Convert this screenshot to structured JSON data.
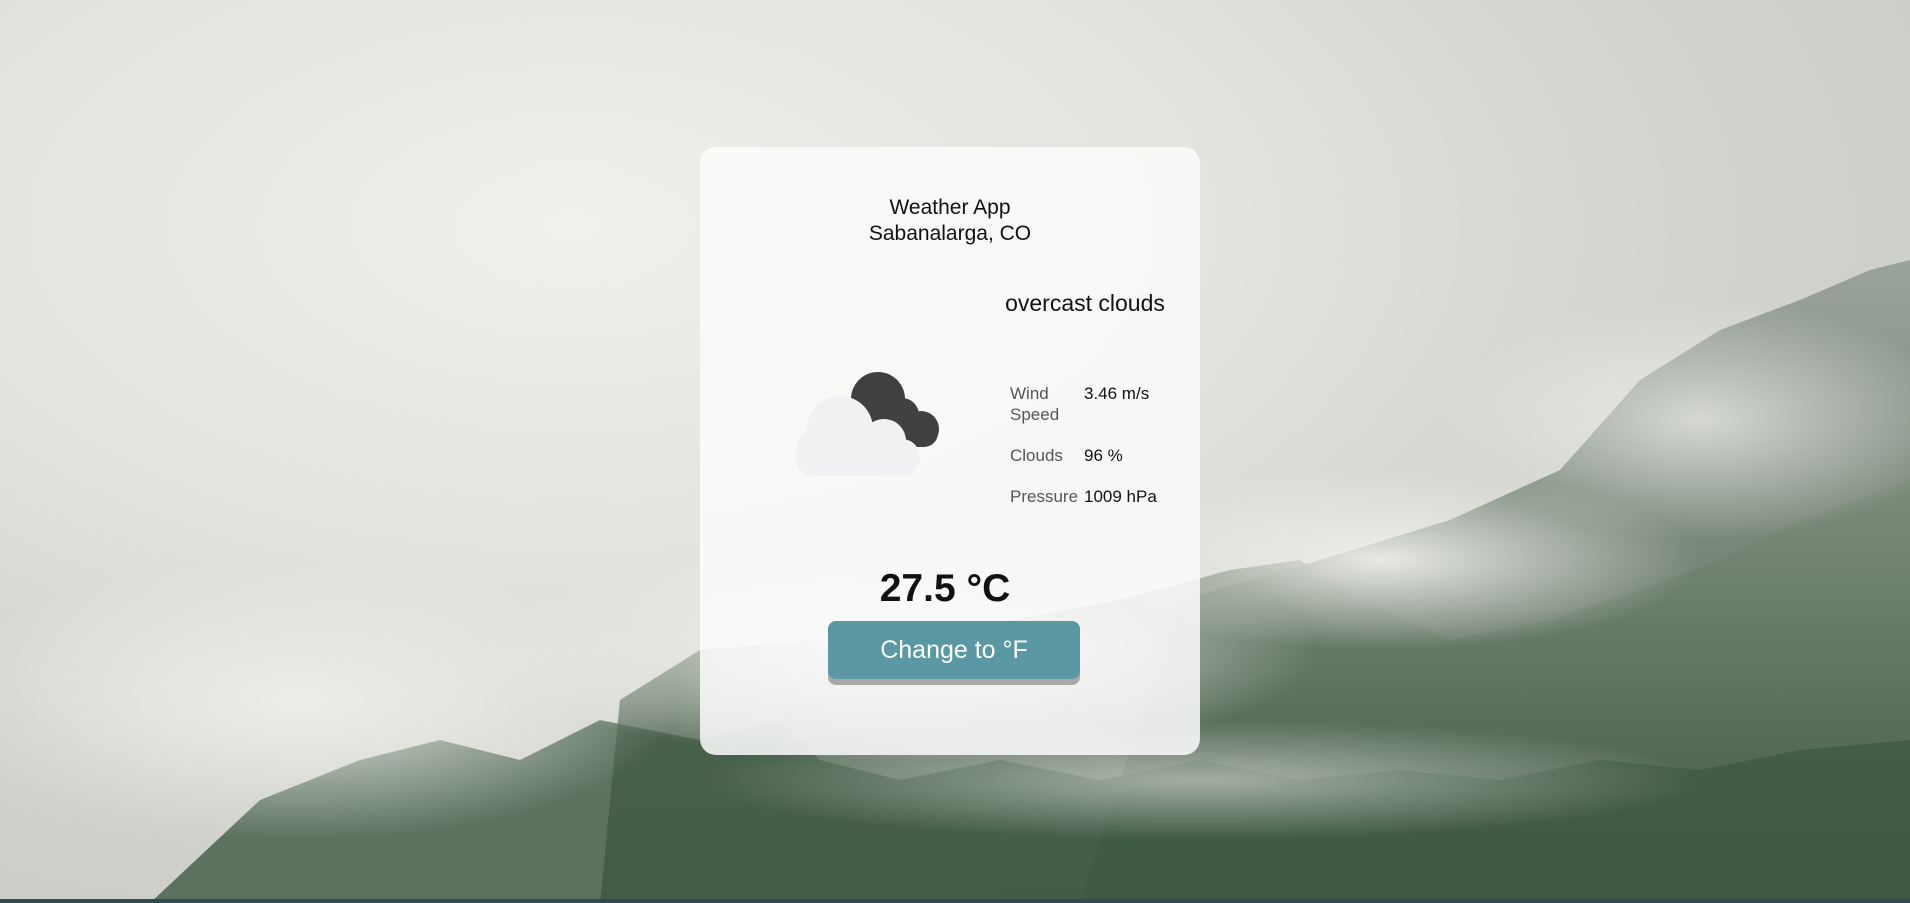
{
  "header": {
    "app_title": "Weather App",
    "location": "Sabanalarga, CO"
  },
  "weather": {
    "icon": "overcast-clouds-icon",
    "description": "overcast clouds",
    "stats": [
      {
        "label": "Wind Speed",
        "value": "3.46 m/s"
      },
      {
        "label": "Clouds",
        "value": "96 %"
      },
      {
        "label": "Pressure",
        "value": "1009 hPa"
      }
    ],
    "temperature": "27.5 °C"
  },
  "controls": {
    "unit_toggle_label": "Change to °F"
  },
  "colors": {
    "button": "#5a98a3",
    "button_shadow": "#a8a8a6",
    "cloud_dark": "#404040",
    "cloud_light": "#f1f1f3"
  }
}
